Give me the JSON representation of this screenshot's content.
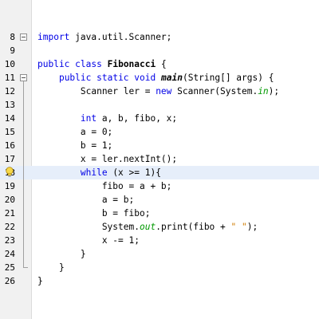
{
  "editor": {
    "lines": [
      {
        "num": "8",
        "segments": [
          {
            "t": "import",
            "c": "kw"
          },
          {
            "t": " java.util.Scanner;",
            "c": ""
          }
        ]
      },
      {
        "num": "9",
        "segments": []
      },
      {
        "num": "10",
        "segments": [
          {
            "t": "public",
            "c": "kw"
          },
          {
            "t": " ",
            "c": ""
          },
          {
            "t": "class",
            "c": "kw"
          },
          {
            "t": " ",
            "c": ""
          },
          {
            "t": "Fibonacci",
            "c": "bold"
          },
          {
            "t": " {",
            "c": ""
          }
        ]
      },
      {
        "num": "11",
        "segments": [
          {
            "t": "    ",
            "c": ""
          },
          {
            "t": "public",
            "c": "kw"
          },
          {
            "t": " ",
            "c": ""
          },
          {
            "t": "static",
            "c": "kw"
          },
          {
            "t": " ",
            "c": ""
          },
          {
            "t": "void",
            "c": "kw"
          },
          {
            "t": " ",
            "c": ""
          },
          {
            "t": "main",
            "c": "ital"
          },
          {
            "t": "(String[] args) {",
            "c": ""
          }
        ]
      },
      {
        "num": "12",
        "segments": [
          {
            "t": "        Scanner ler = ",
            "c": ""
          },
          {
            "t": "new",
            "c": "kw"
          },
          {
            "t": " Scanner(System.",
            "c": ""
          },
          {
            "t": "in",
            "c": "fld"
          },
          {
            "t": ");",
            "c": ""
          }
        ]
      },
      {
        "num": "13",
        "segments": []
      },
      {
        "num": "14",
        "segments": [
          {
            "t": "        ",
            "c": ""
          },
          {
            "t": "int",
            "c": "kw"
          },
          {
            "t": " a, b, fibo, x;",
            "c": ""
          }
        ]
      },
      {
        "num": "15",
        "segments": [
          {
            "t": "        a = 0;",
            "c": ""
          }
        ]
      },
      {
        "num": "16",
        "segments": [
          {
            "t": "        b = 1;",
            "c": ""
          }
        ]
      },
      {
        "num": "17",
        "segments": [
          {
            "t": "        x = ler.nextInt();",
            "c": ""
          }
        ]
      },
      {
        "num": "18",
        "segments": [
          {
            "t": "        ",
            "c": ""
          },
          {
            "t": "while",
            "c": "kw"
          },
          {
            "t": " (x >= 1){",
            "c": ""
          }
        ]
      },
      {
        "num": "19",
        "segments": [
          {
            "t": "            fibo = a + b;",
            "c": ""
          }
        ]
      },
      {
        "num": "20",
        "segments": [
          {
            "t": "            a = b;",
            "c": ""
          }
        ]
      },
      {
        "num": "21",
        "segments": [
          {
            "t": "            b = fibo;",
            "c": ""
          }
        ]
      },
      {
        "num": "22",
        "segments": [
          {
            "t": "            System.",
            "c": ""
          },
          {
            "t": "out",
            "c": "fld"
          },
          {
            "t": ".print(fibo + ",
            "c": ""
          },
          {
            "t": "\" \"",
            "c": "str"
          },
          {
            "t": ");",
            "c": ""
          }
        ]
      },
      {
        "num": "23",
        "segments": [
          {
            "t": "            x -= 1;",
            "c": ""
          }
        ]
      },
      {
        "num": "24",
        "segments": [
          {
            "t": "        }",
            "c": ""
          }
        ]
      },
      {
        "num": "25",
        "segments": [
          {
            "t": "    }",
            "c": ""
          }
        ]
      },
      {
        "num": "26",
        "segments": [
          {
            "t": "}",
            "c": ""
          }
        ]
      }
    ],
    "current_line": "18",
    "hint_icon": "lightbulb-icon",
    "fold_icon": "collapse-icon",
    "colors": {
      "keyword": "#0000e6",
      "field": "#009900",
      "string": "#ce7b00",
      "current_line_bg": "#e6eefa",
      "gutter_bg": "#f1f1f1"
    }
  }
}
